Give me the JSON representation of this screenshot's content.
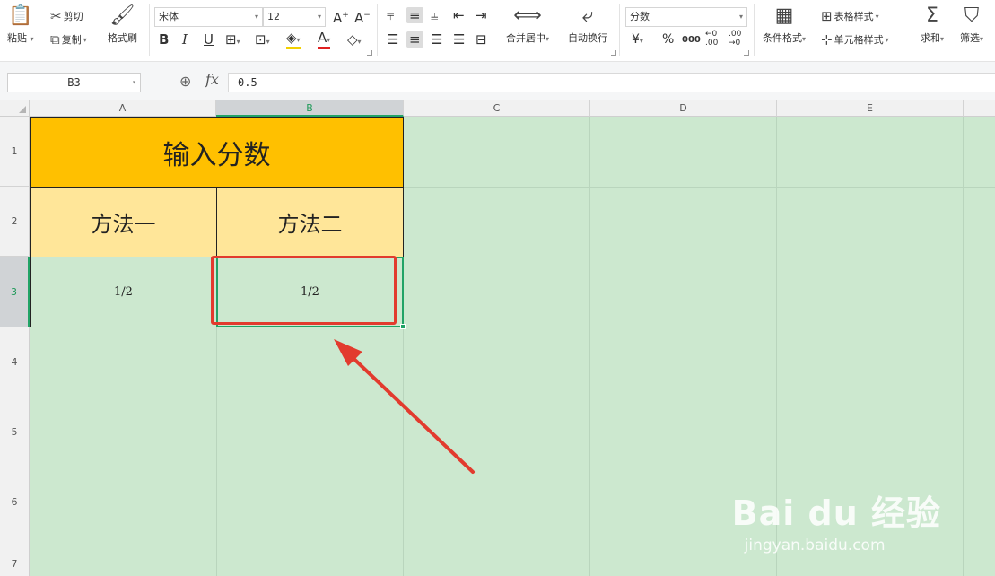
{
  "ribbon": {
    "paste": "粘贴",
    "cut": "剪切",
    "copy": "复制",
    "format_painter": "格式刷",
    "font_name": "宋体",
    "font_size": "12",
    "bold": "B",
    "italic": "I",
    "underline": "U",
    "merge_center": "合并居中",
    "auto_wrap": "自动换行",
    "number_format": "分数",
    "currency": "¥",
    "percent": "%",
    "thousands": "000",
    "decimal_increase": "←0 .00",
    "decimal_decrease": ".00 →0",
    "table_style": "表格样式",
    "cell_style": "单元格样式",
    "conditional_format": "条件格式",
    "sum": "求和",
    "filter": "筛选"
  },
  "formula_bar": {
    "name_box": "B3",
    "fx_label": "fx",
    "value": "0.5"
  },
  "columns": [
    "A",
    "B",
    "C",
    "D",
    "E"
  ],
  "rows": [
    "1",
    "2",
    "3",
    "4",
    "5",
    "6",
    "7"
  ],
  "cells": {
    "A1": "输入分数",
    "A2": "方法一",
    "B2": "方法二",
    "A3": "1/2",
    "B3": "1/2"
  },
  "watermark": {
    "logo": "Bai du 经验",
    "url": "jingyan.baidu.com"
  },
  "colors": {
    "title_fill": "#ffc000",
    "header_fill": "#ffe699",
    "sheet_background": "#cce8cf",
    "selection": "#21a366",
    "annotation_red": "#e23b2e"
  }
}
